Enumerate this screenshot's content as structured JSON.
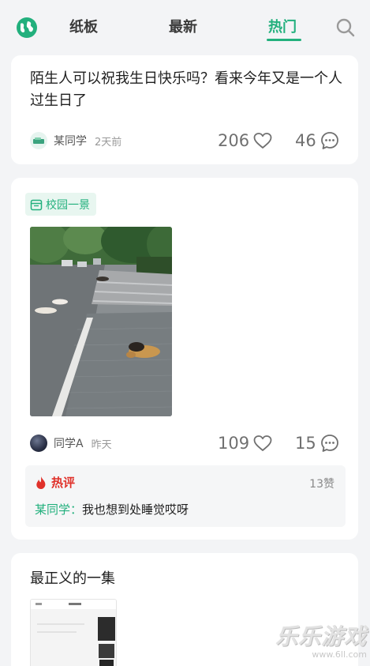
{
  "header": {
    "tabs": [
      {
        "label": "纸板"
      },
      {
        "label": "最新"
      },
      {
        "label": "热门"
      }
    ],
    "active_tab": "热门",
    "accent_color": "#22b07d"
  },
  "posts": [
    {
      "text": "陌生人可以祝我生日快乐吗？看来今年又是一个人过生日了",
      "author": "某同学",
      "time": "2天前",
      "likes": "206",
      "comments": "46"
    },
    {
      "tag": "校园一景",
      "author": "同学A",
      "time": "昨天",
      "likes": "109",
      "comments": "15",
      "hot_comment": {
        "label": "热评",
        "likes": "13赞",
        "author": "某同学：",
        "text": "我也想到处睡觉哎呀"
      }
    },
    {
      "title": "最正义的一集"
    }
  ],
  "watermark": {
    "main": "乐乐游戏",
    "url": "www.6ll.com"
  },
  "icons": {
    "globe": "globe-icon",
    "search": "search-icon",
    "heart": "heart-icon",
    "comment": "comment-icon",
    "flame": "flame-icon",
    "calendar": "calendar-icon"
  }
}
